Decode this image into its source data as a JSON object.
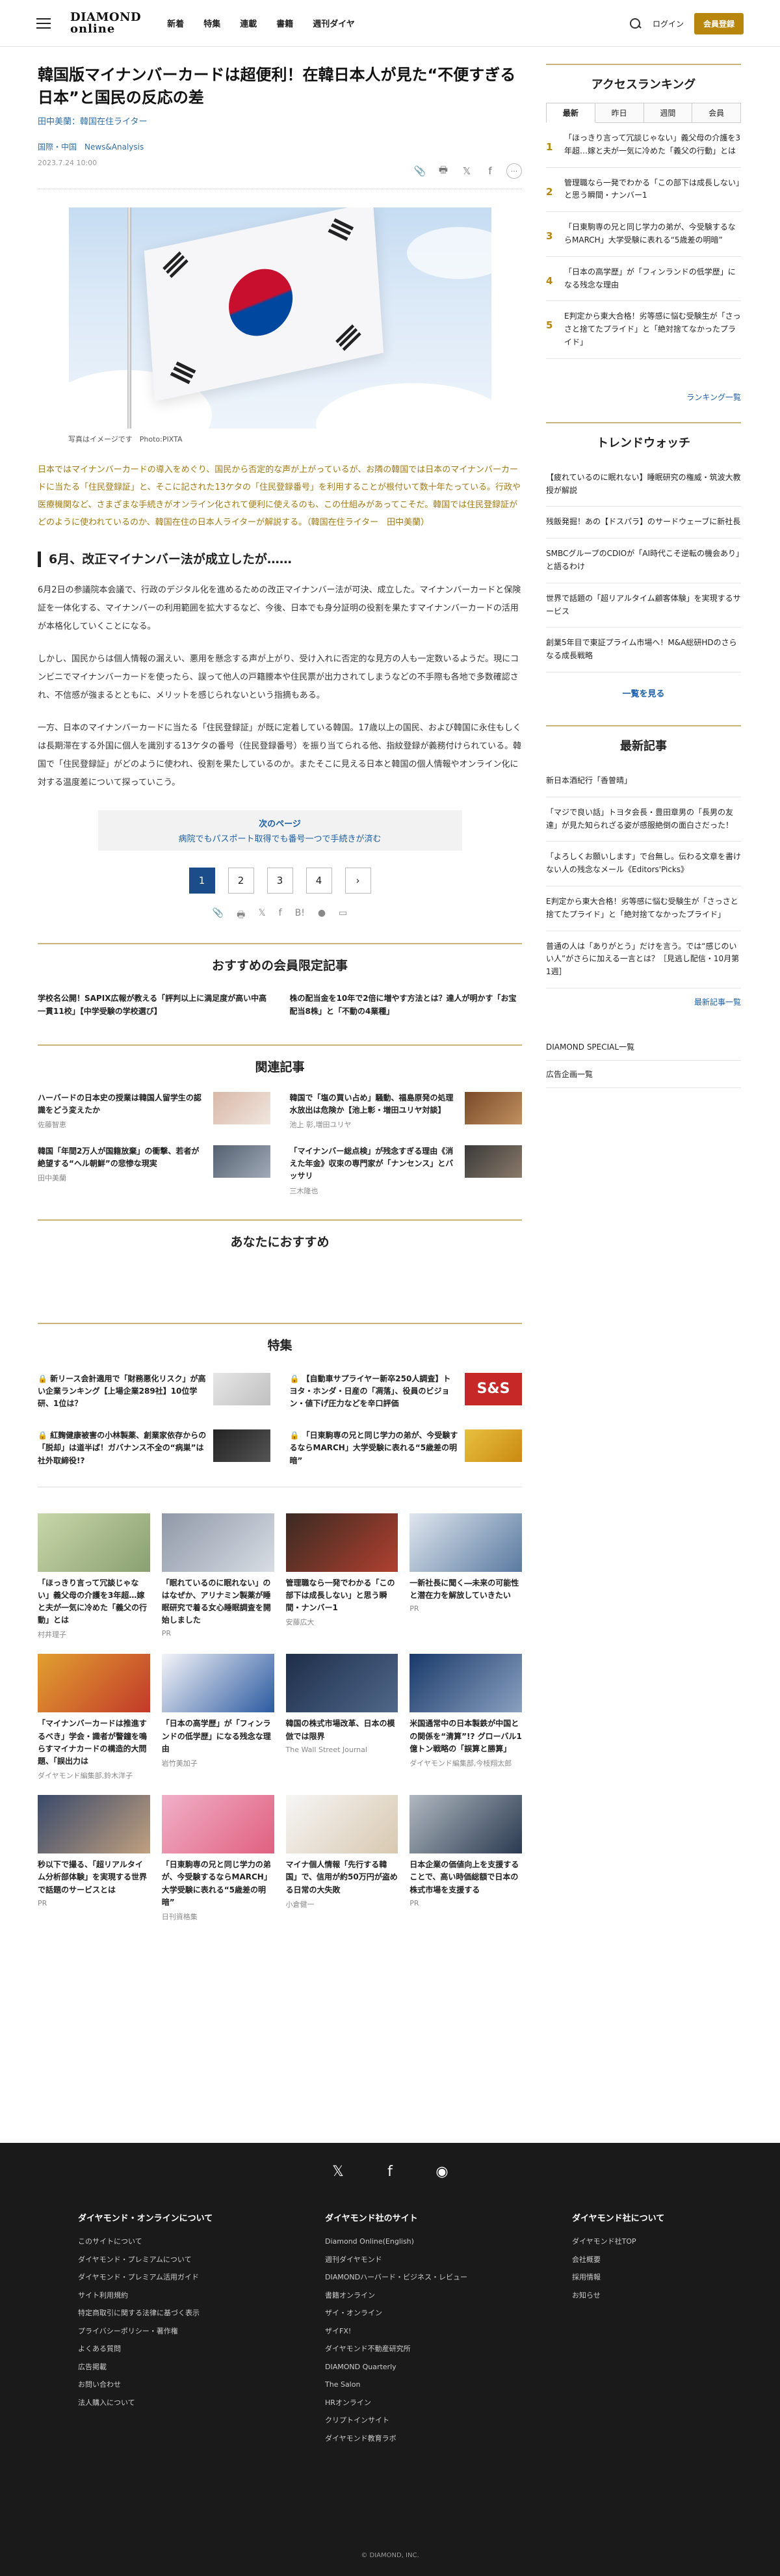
{
  "header": {
    "logo_line1": "DIAMOND",
    "logo_line2": "online",
    "nav": [
      "新着",
      "特集",
      "連載",
      "書籍",
      "週刊ダイヤ"
    ],
    "login": "ログイン",
    "member": "会員登録"
  },
  "article": {
    "title": "韓国版マイナンバーカードは超便利！在韓日本人が見た“不便すぎる日本”と国民の反応の差",
    "author": "田中美蘭：韓国在住ライター",
    "category": "国際・中国　News&Analysis",
    "date": "2023.7.24 10:00",
    "caption": "写真はイメージです　Photo:PIXTA",
    "lead": "日本ではマイナンバーカードの導入をめぐり、国民から否定的な声が上がっているが、お隣の韓国では日本のマイナンバーカードに当たる「住民登録証」と、そこに記された13ケタの「住民登録番号」を利用することが根付いて数十年たっている。行政や医療機関など、さまざまな手続きがオンライン化されて便利に使えるのも、この仕組みがあってこそだ。韓国では住民登録証がどのように使われているのか、韓国在住の日本人ライターが解説する。（韓国在住ライター　田中美蘭）",
    "h2": "6月、改正マイナンバー法が成立したが……",
    "p1": "6月2日の参議院本会議で、行政のデジタル化を進めるための改正マイナンバー法が可決、成立した。マイナンバーカードと保険証を一体化する、マイナンバーの利用範囲を拡大するなど、今後、日本でも身分証明の役割を果たすマイナンバーカードの活用が本格化していくことになる。",
    "p2": "しかし、国民からは個人情報の漏えい、悪用を懸念する声が上がり、受け入れに否定的な見方の人も一定数いるようだ。現にコンビニでマイナンバーカードを使ったら、誤って他人の戸籍謄本や住民票が出力されてしまうなどの不手際も各地で多数確認され、不信感が強まるとともに、メリットを感じられないという指摘もある。",
    "p3": "一方、日本のマイナンバーカードに当たる「住民登録証」が既に定着している韓国。17歳以上の国民、および韓国に永住もしくは長期滞在する外国に個人を識別する13ケタの番号（住民登録番号）を振り当てられる他、指紋登録が義務付けられている。韓国で「住民登録証」がどのように使われ、役割を果たしているのか。またそこに見える日本と韓国の個人情報やオンライン化に対する温度差について探っていこう。",
    "next_label": "次のページ",
    "next_title": "病院でもパスポート取得でも番号一つで手続きが済む",
    "pages": [
      "1",
      "2",
      "3",
      "4"
    ],
    "next_page": "›"
  },
  "member_section": {
    "title": "おすすめの会員限定記事",
    "items": [
      "学校名公開！SAPIX広報が教える「評判以上に満足度が高い中高一貫11校」【中学受験の学校選び】",
      "株の配当金を10年で2倍に増やす方法とは？達人が明かす「お宝配当8株」と「不動の4業種」"
    ]
  },
  "related": {
    "title": "関連記事",
    "items": [
      {
        "t": "ハーバードの日本史の授業は韓国人留学生の認識をどう変えたか",
        "a": "佐藤智恵"
      },
      {
        "t": "韓国で「塩の買い占め」騒動、福島原発の処理水放出は危険か【池上彰・増田ユリヤ対談】",
        "a": "池上 彰,増田ユリヤ"
      },
      {
        "t": "韓国「年間2万人が国籍放棄」の衝撃、若者が絶望する“ヘル朝鮮”の悲惨な現実",
        "a": "田中美蘭"
      },
      {
        "t": "「マイナンバー総点検」が残念すぎる理由《消えた年金》収束の専門家が「ナンセンス」とバッサリ",
        "a": "三木隆也"
      }
    ]
  },
  "recommend_title": "あなたにおすすめ",
  "feature": {
    "title": "特集",
    "items": [
      "新リース会計適用で「財務悪化リスク」が高い企業ランキング【上場企業289社】10位学研、1位は？",
      "【自動車サプライヤー新卒250人調査】トヨタ・ホンダ・日産の「凋落」、役員のビジョン・値下げ圧力などを辛口評価",
      "紅麹健康被害の小林製薬、創業家依存からの「脱却」は道半ば！ガバナンス不全の“病巣”は社外取締役!?",
      "「日東駒専の兄と同じ学力の弟が、今受験するならMARCH」大学受験に表れる“5歳差の明暗”"
    ],
    "feat_thumb_text": "S&S"
  },
  "cards": [
    {
      "t": "「ほっきり言って冗談じゃない」義父母の介護を3年超…嫁と夫が一気に冷めた「義父の行動」とは",
      "a": "村井理子"
    },
    {
      "t": "「眠れているのに眠れない」のはなぜか、アリナミン製薬が睡眠研究で着る女心睡眠調査を開始しました",
      "a": "PR"
    },
    {
      "t": "管理職なら一発でわかる「この部下は成長しない」と思う瞬間・ナンバー1",
      "a": "安藤広大"
    },
    {
      "t": "一新社長に聞く―未来の可能性と潜在力を解放していきたい",
      "a": "PR"
    },
    {
      "t": "「マイナンバーカードは推進するべき」学会・識者が警鐘を鳴らすマイナカードの構造的大問題、「誤出力は",
      "a": "ダイヤモンド編集部,鈴木洋子"
    },
    {
      "t": "「日本の高学歴」が「フィンランドの低学歴」になる残念な理由",
      "a": "岩竹美加子"
    },
    {
      "t": "韓国の株式市場改革、日本の模倣では限界",
      "a": "The Wall Street Journal"
    },
    {
      "t": "米国通常中の日本製鉄が中国との関係を“清算”!? グローバル1億トン戦略の「誤算と勝算」",
      "a": "ダイヤモンド編集部,今枝翔太郎"
    },
    {
      "t": "秒以下で撮る、「超リアルタイム分析部体験」を実現する世界で話題のサービスとは",
      "a": "PR"
    },
    {
      "t": "「日東駒専の兄と同じ学力の弟が、今受験するならMARCH」大学受験に表れる“5歳差の明暗”",
      "a": "日刊資格集"
    },
    {
      "t": "マイナ個人情報「先行する韓国」で、信用が約50万円が盗める日常の大失敗",
      "a": "小倉健一"
    },
    {
      "t": "日本企業の価値向上を支援することで、高い時価総額で日本の株式市場を支援する",
      "a": "PR"
    }
  ],
  "sidebar": {
    "ranking_title": "アクセスランキング",
    "tabs": [
      "最新",
      "昨日",
      "週間",
      "会員"
    ],
    "ranking": [
      "「ほっきり言って冗談じゃない」義父母の介護を3年超…嫁と夫が一気に冷めた「義父の行動」とは",
      "管理職なら一発でわかる「この部下は成長しない」と思う瞬間・ナンバー1",
      "「日東駒専の兄と同じ学力の弟が、今受験するならMARCH」大学受験に表れる“5歳差の明暗”",
      "「日本の高学歴」が「フィンランドの低学歴」になる残念な理由",
      "E判定から東大合格！劣等感に悩む受験生が「さっさと捨てたプライド」と「絶対捨てなかったプライド」"
    ],
    "ranking_link": "ランキング一覧",
    "trend_title": "トレンドウォッチ",
    "trends": [
      "【疲れているのに眠れない】睡眠研究の権威・筑波大教授が解説",
      "残飯発掘！あの【ドスパラ】のサードウェーブに新社長",
      "SMBCグループのCDIOが「AI時代こそ逆転の機会あり」と語るわけ",
      "世界で話題の「超リアルタイム顧客体験」を実現するサービス",
      "創業5年目で東証プライム市場へ！M&A総研HDのさらなる成長戦略"
    ],
    "trend_more": "一覧を見る",
    "new_title": "最新記事",
    "new_items": [
      "新日本酒紀行「香曽晴」",
      "「マジで良い話」トヨタ会長・豊田章男の「長男の友達」が見た知られざる姿が感服絶倒の面白さだった！",
      "「よろしくお願いします」で台無し。伝わる文章を書けない人の残念なメール《Editors'Picks》",
      "E判定から東大合格！劣等感に悩む受験生が「さっさと捨てたプライド」と「絶対捨てなかったプライド」",
      "普通の人は「ありがとう」だけを言う。では“感じのいい人”がさらに加える一言とは？［見逃し配信・10月第1週］"
    ],
    "new_more": "最新記事一覧",
    "links": [
      "DIAMOND SPECIAL一覧",
      "広告企画一覧"
    ]
  },
  "footer": {
    "col1_title": "ダイヤモンド・オンラインについて",
    "col1": [
      "このサイトについて",
      "ダイヤモンド・プレミアムについて",
      "ダイヤモンド・プレミアム活用ガイド",
      "サイト利用規約",
      "特定商取引に関する法律に基づく表示",
      "プライバシーポリシー・著作権",
      "よくある質問",
      "広告掲載",
      "お問い合わせ",
      "法人購入について"
    ],
    "col2_title": "ダイヤモンド社のサイト",
    "col2": [
      "Diamond Online(English)",
      "週刊ダイヤモンド",
      "DIAMONDハーバード・ビジネス・レビュー",
      "書籍オンライン",
      "ザイ・オンライン",
      "ザイFX!",
      "ダイヤモンド不動産研究所",
      "DIAMOND Quarterly",
      "The Salon",
      "HRオンライン",
      "クリプトインサイト",
      "ダイヤモンド教育ラボ"
    ],
    "col3_title": "ダイヤモンド社について",
    "col3": [
      "ダイヤモンド社TOP",
      "会社概要",
      "採用情報",
      "お知らせ"
    ],
    "copyright": "© DIAMOND, INC."
  }
}
